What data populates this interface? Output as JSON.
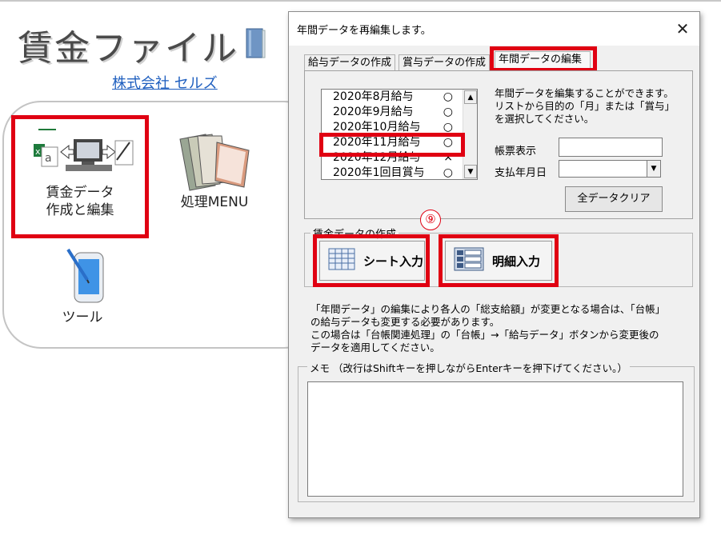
{
  "background": {
    "title": "賃金ファイル",
    "company_link": "株式会社 セルズ",
    "menu": [
      {
        "label_line1": "賃金データ",
        "label_line2": "作成と編集",
        "icon": "payroll-computer-icon"
      },
      {
        "label_line1": "処理MENU",
        "label_line2": "",
        "icon": "books-icon"
      },
      {
        "label_line1": "ツール",
        "label_line2": "",
        "icon": "tablet-pen-icon"
      }
    ]
  },
  "dialog": {
    "title": "年間データを再編集します。",
    "close": "✕",
    "tabs": [
      "給与データの作成",
      "賞与データの作成",
      "年間データの編集"
    ],
    "list": [
      {
        "label": "2020年8月給与",
        "mark": "○"
      },
      {
        "label": "2020年9月給与",
        "mark": "○"
      },
      {
        "label": "2020年10月給与",
        "mark": "○"
      },
      {
        "label": "2020年11月給与",
        "mark": "○"
      },
      {
        "label": "2020年12月給与",
        "mark": "×"
      },
      {
        "label": "2020年1回目賞与",
        "mark": "○"
      }
    ],
    "help": "年間データを編集することができます。\nリストから目的の「月」または「賞与」\nを選択してください。",
    "ledger_label": "帳票表示",
    "ledger_value": "",
    "paydate_label": "支払年月日",
    "paydate_value": "",
    "clear_button": "全データクリア",
    "group_title": "賃金データの作成",
    "sheet_button": "シート入力",
    "detail_button": "明細入力",
    "step_number": "⑨",
    "note": "「年間データ」の編集により各人の「総支給額」が変更となる場合は、「台帳」\nの給与データも変更する必要があります。\nこの場合は「台帳関連処理」の「台帳」→「給与データ」ボタンから変更後の\nデータを適用してください。",
    "memo_label": "メモ （改行はShiftキーを押しながらEnterキーを押下げてください。）",
    "memo_value": ""
  },
  "colors": {
    "highlight": "#e00012",
    "link": "#1f5fbf"
  }
}
